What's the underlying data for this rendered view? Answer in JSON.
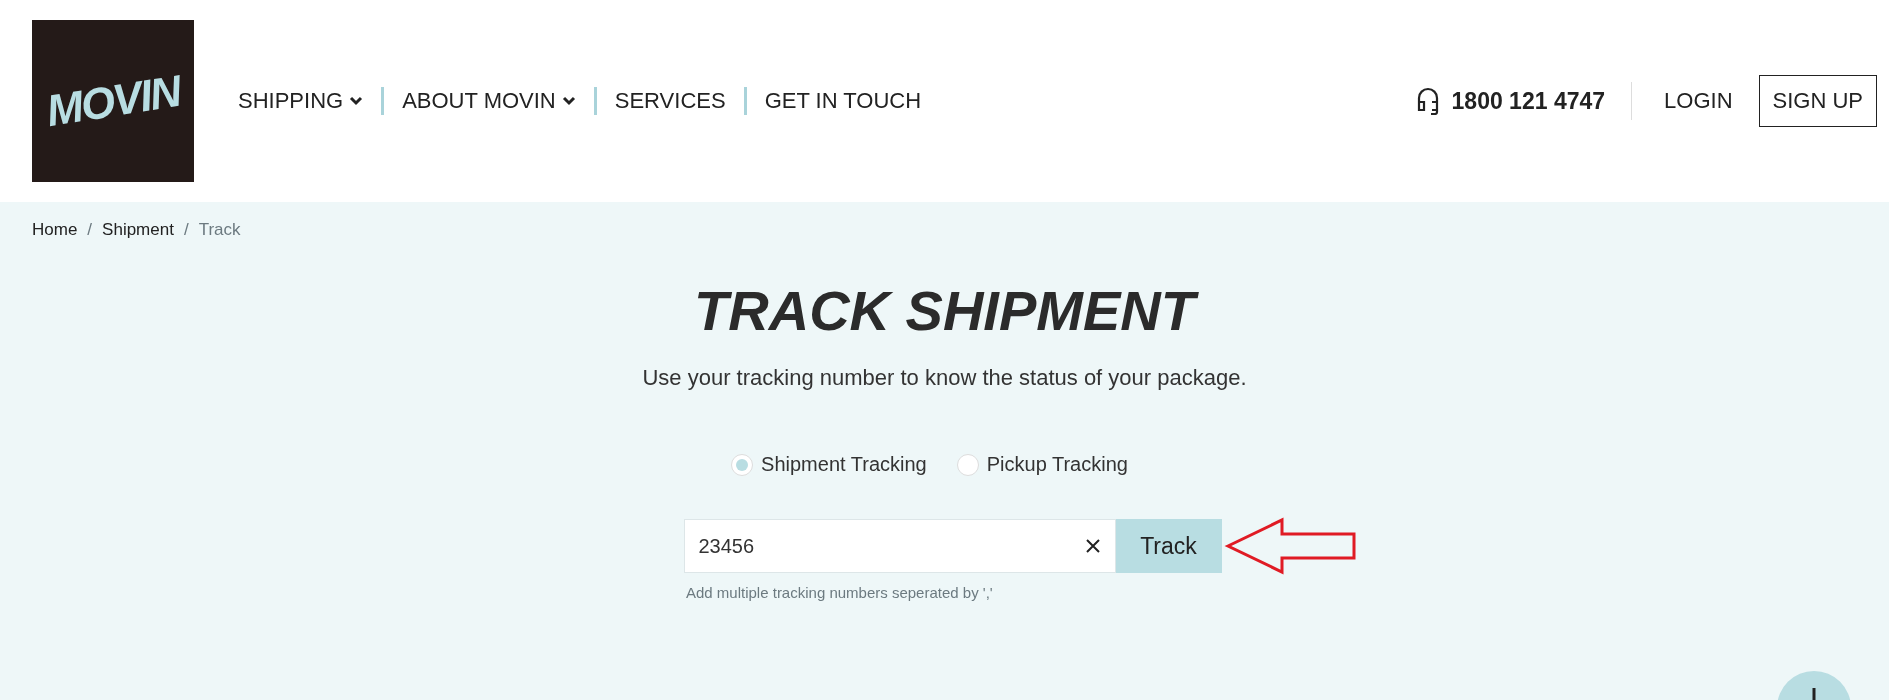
{
  "logo": {
    "text": "MOVIN"
  },
  "nav": [
    {
      "label": "SHIPPING",
      "dropdown": true
    },
    {
      "label": "ABOUT MOVIN",
      "dropdown": true
    },
    {
      "label": "SERVICES",
      "dropdown": false
    },
    {
      "label": "GET IN TOUCH",
      "dropdown": false
    }
  ],
  "phone": "1800 121 4747",
  "login": "LOGIN",
  "signup": "SIGN UP",
  "breadcrumb": [
    {
      "label": "Home",
      "current": false
    },
    {
      "label": "Shipment",
      "current": false
    },
    {
      "label": "Track",
      "current": true
    }
  ],
  "breadcrumb_separator": "/",
  "title": "TRACK SHIPMENT",
  "subtitle": "Use your tracking number to know the status of your package.",
  "tracking_types": [
    {
      "label": "Shipment Tracking",
      "selected": true
    },
    {
      "label": "Pickup Tracking",
      "selected": false
    }
  ],
  "tracking_field": {
    "value": "23456"
  },
  "track_button": "Track",
  "hint": "Add multiple tracking numbers seperated by ','"
}
